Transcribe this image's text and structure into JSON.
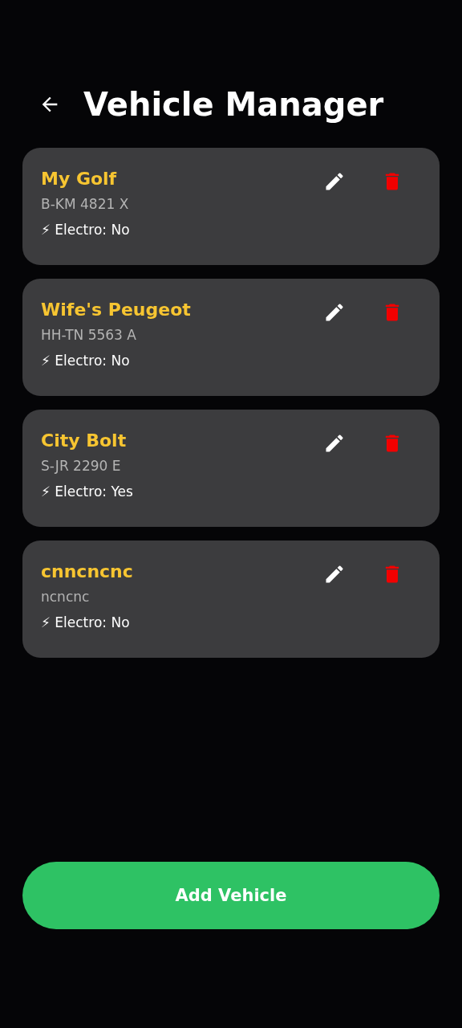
{
  "header": {
    "title": "Vehicle Manager"
  },
  "vehicles": [
    {
      "name": "My Golf",
      "plate": "B-KM 4821 X",
      "electro": "⚡ Electro: No"
    },
    {
      "name": "Wife's Peugeot",
      "plate": "HH-TN 5563 A",
      "electro": "⚡ Electro: No"
    },
    {
      "name": "City Bolt",
      "plate": "S-JR 2290 E",
      "electro": "⚡ Electro: Yes"
    },
    {
      "name": "cnncncnc",
      "plate": "ncncnc",
      "electro": "⚡ Electro: No"
    }
  ],
  "add_button": "Add Vehicle"
}
